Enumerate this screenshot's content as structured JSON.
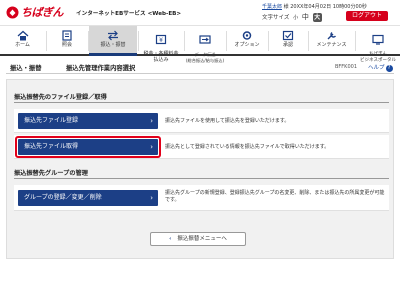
{
  "header": {
    "bank_name": "ちばぎん",
    "service_name": "インターネットEBサービス <Web-EB>",
    "user_name": "千葉太郎",
    "user_suffix": "様",
    "last_login": "20XX年04月02日 10時00分00秒",
    "font_size_label": "文字サイズ",
    "size_small": "小",
    "size_medium": "中",
    "size_large": "大",
    "logout_label": "ログアウト"
  },
  "nav": {
    "items": [
      {
        "label": "ホーム",
        "icon": "home-icon"
      },
      {
        "label": "照会",
        "icon": "inquiry-icon"
      },
      {
        "label": "振込・振替",
        "icon": "transfer-icon",
        "active": true
      },
      {
        "label": "税金・各種料金\n払込み",
        "icon": "tax-icon"
      },
      {
        "label": "データ伝送\n(総合振込/給与振込)",
        "icon": "data-transmission-icon"
      },
      {
        "label": "オプション",
        "icon": "option-icon"
      },
      {
        "label": "承認",
        "icon": "approval-icon"
      },
      {
        "label": "メンテナンス",
        "icon": "maintenance-icon"
      },
      {
        "label": "ちばぎん\nビジネスポータル",
        "icon": "portal-icon"
      }
    ]
  },
  "page": {
    "category": "振込・振替",
    "title": "振込先管理作業内容選択",
    "screen_code": "BFFK001",
    "help_label": "ヘルプ"
  },
  "sections": {
    "file": {
      "heading": "振込振替先のファイル登録／取得",
      "rows": [
        {
          "button": "振込先ファイル登録",
          "description": "振込先ファイルを使用して振込先を登録いただけます。"
        },
        {
          "button": "振込先ファイル取得",
          "description": "振込先として登録されている情報を振込先ファイルで取得いただけます。"
        }
      ]
    },
    "group": {
      "heading": "振込振替先グループの管理",
      "rows": [
        {
          "button": "グループの登録／変更／削除",
          "description": "振込先グループの新規登録、登録振込先グループの名変更、削除、または振込先の所属変更が可能です。"
        }
      ]
    }
  },
  "back_button": "振込振替メニューへ",
  "colors": {
    "brand_red": "#d6001c",
    "button_blue": "#1c3f86"
  }
}
